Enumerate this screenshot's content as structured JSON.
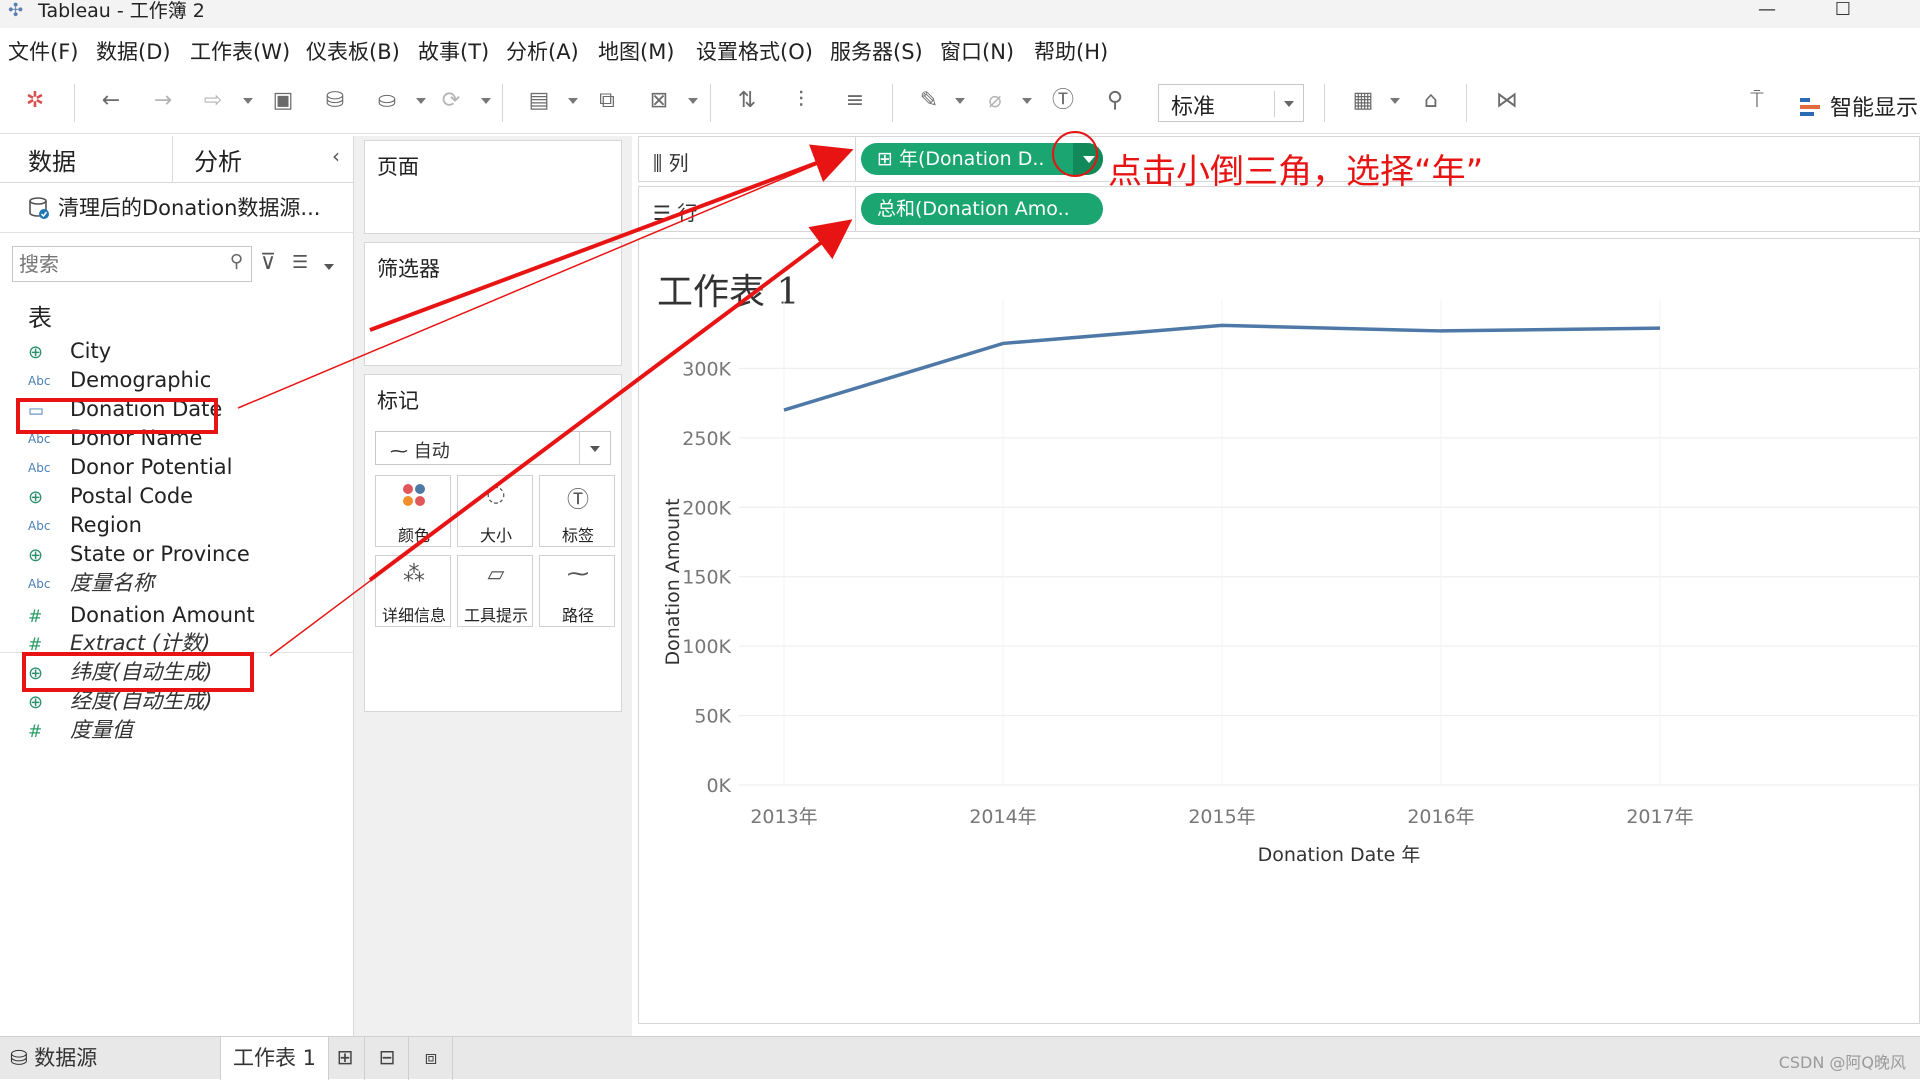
{
  "window": {
    "title": "Tableau - 工作簿 2"
  },
  "menu": [
    "文件(F)",
    "数据(D)",
    "工作表(W)",
    "仪表板(B)",
    "故事(T)",
    "分析(A)",
    "地图(M)",
    "设置格式(O)",
    "服务器(S)",
    "窗口(N)",
    "帮助(H)"
  ],
  "toolbar": {
    "fit_value": "标准",
    "show_me_label": "智能显示"
  },
  "data_pane": {
    "tabs": [
      "数据",
      "分析"
    ],
    "datasource": "清理后的Donation数据源...",
    "search_placeholder": "搜索",
    "section_header": "表",
    "fields": [
      {
        "name": "City",
        "icon": "globe-icon",
        "italic": false
      },
      {
        "name": "Demographic",
        "icon": "abc-icon",
        "italic": false
      },
      {
        "name": "Donation Date",
        "icon": "calendar-icon",
        "italic": false
      },
      {
        "name": "Donor Name",
        "icon": "abc-icon",
        "italic": false
      },
      {
        "name": "Donor Potential",
        "icon": "abc-icon",
        "italic": false
      },
      {
        "name": "Postal Code",
        "icon": "globe-icon",
        "italic": false
      },
      {
        "name": "Region",
        "icon": "abc-icon",
        "italic": false
      },
      {
        "name": "State or Province",
        "icon": "globe-icon",
        "italic": false
      },
      {
        "name": "度量名称",
        "icon": "abc-icon",
        "italic": true
      }
    ],
    "measures": [
      {
        "name": "Donation Amount",
        "icon": "hash-icon",
        "italic": false
      },
      {
        "name": "Extract (计数)",
        "icon": "hash-icon",
        "italic": true
      },
      {
        "name": "纬度(自动生成)",
        "icon": "globe-icon",
        "italic": true
      },
      {
        "name": "经度(自动生成)",
        "icon": "globe-icon",
        "italic": true
      },
      {
        "name": "度量值",
        "icon": "hash-icon",
        "italic": true
      }
    ]
  },
  "cards": {
    "pages": "页面",
    "filters": "筛选器",
    "marks": "标记",
    "marks_type": "自动",
    "mark_buttons": [
      "颜色",
      "大小",
      "标签",
      "详细信息",
      "工具提示",
      "路径"
    ]
  },
  "shelves": {
    "columns_label": "列",
    "rows_label": "行",
    "columns_pill": "年(Donation D..",
    "rows_pill": "总和(Donation Amo.."
  },
  "annotation": "点击小倒三角，选择“年”",
  "sheet": {
    "title": "工作表 1"
  },
  "chart_data": {
    "type": "line",
    "categories": [
      "2013年",
      "2014年",
      "2015年",
      "2016年",
      "2017年"
    ],
    "series": [
      {
        "values": [
          270000,
          318000,
          331000,
          327000,
          329000
        ],
        "color": "#4e79a7"
      }
    ],
    "xlabel": "Donation Date 年",
    "ylabel": "Donation Amount",
    "yticks": [
      "0K",
      "50K",
      "100K",
      "150K",
      "200K",
      "250K",
      "300K"
    ],
    "ylim": [
      0,
      350000
    ],
    "grid": true
  },
  "statusbar": {
    "datasource_tab": "数据源",
    "sheet_tab": "工作表 1",
    "watermark": "CSDN @阿Q晚风"
  },
  "colors": {
    "accent_red": "#e81414",
    "pill_green": "#1aa571",
    "line_blue": "#4e79a7"
  }
}
